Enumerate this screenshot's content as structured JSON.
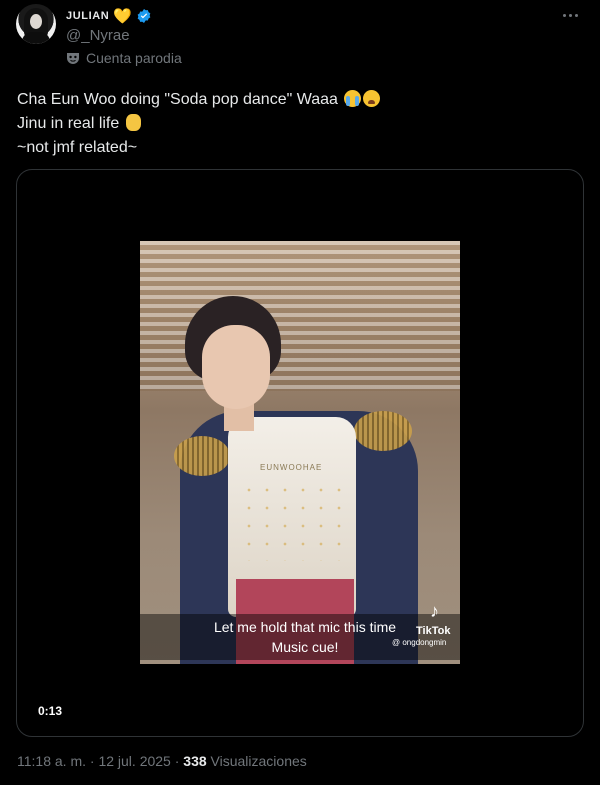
{
  "author": {
    "display_name": "JULIAN",
    "handle": "@_Nyrae",
    "label": "Cuenta parodia",
    "heart_emoji": "💛"
  },
  "tweet": {
    "lines": [
      "Cha Eun Woo doing \"Soda pop dance\" Waaa",
      "Jinu in real life",
      "~not jmf related~"
    ]
  },
  "video": {
    "vest_text": "EUNWOOHAE",
    "caption_line1": "Let me hold that mic this time",
    "caption_line2": "Music cue!",
    "tiktok_label": "TikTok",
    "tiktok_handle": "@ ongdongmin",
    "timer": "0:13"
  },
  "meta": {
    "time_date": "11:18 a. m. · 12 jul. 2025 · ",
    "views_count": "338",
    "views_label": " Visualizaciones"
  },
  "colors": {
    "background": "#000000",
    "text": "#e7e9ea",
    "secondary": "#71767b",
    "verified": "#1d9bf0",
    "border": "#2f3336"
  }
}
